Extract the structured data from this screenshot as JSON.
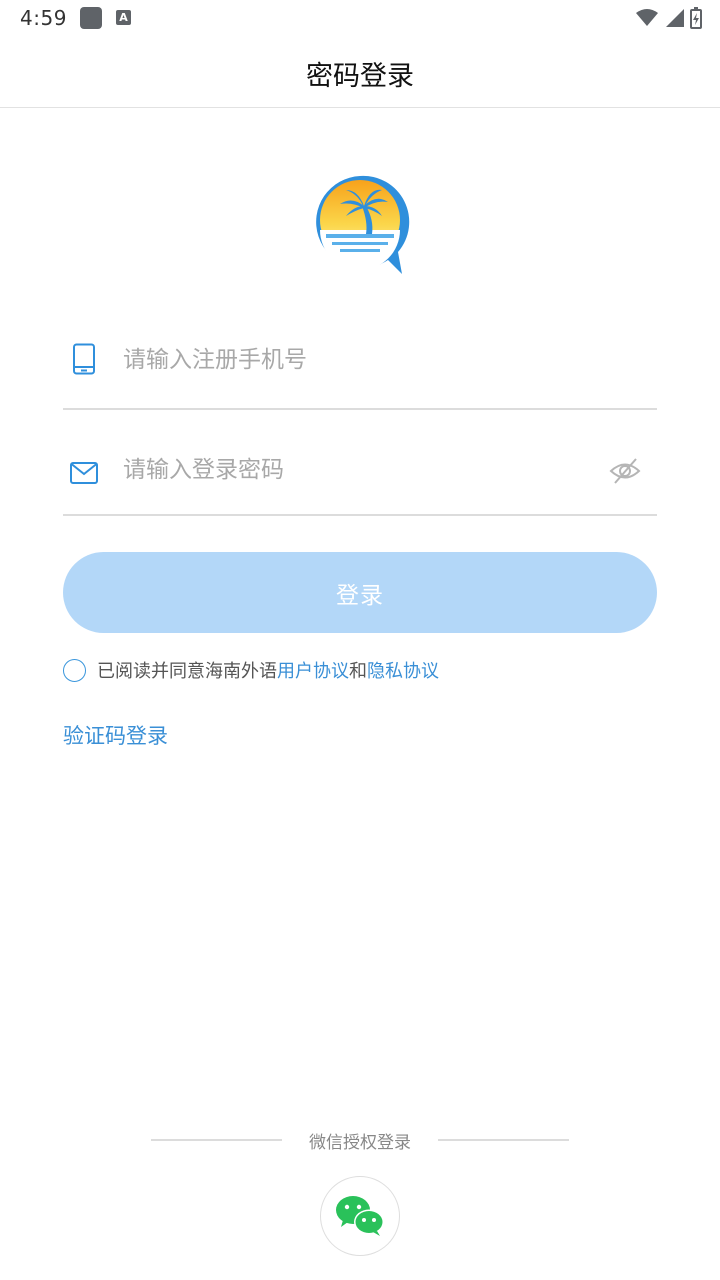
{
  "status_bar": {
    "time": "4:59",
    "a_icon_glyph": "A",
    "icons": [
      "app-icon",
      "a-icon",
      "wifi-icon",
      "signal-icon",
      "battery-icon"
    ]
  },
  "header": {
    "title": "密码登录"
  },
  "form": {
    "phone": {
      "placeholder": "请输入注册手机号",
      "value": "",
      "icon": "phone-icon"
    },
    "password": {
      "placeholder": "请输入登录密码",
      "value": "",
      "icon": "mail-icon",
      "toggle_icon": "eye-hidden-icon"
    },
    "login_button_label": "登录"
  },
  "agreement": {
    "prefix": "已阅读并同意海南外语",
    "user_agreement": "用户协议",
    "conjunction": "和",
    "privacy_agreement": "隐私协议",
    "checked": false
  },
  "code_login_label": "验证码登录",
  "wechat": {
    "label": "微信授权登录",
    "icon": "wechat-icon"
  },
  "colors": {
    "accent": "#3a8fd6",
    "button_disabled": "#b3d7f8",
    "wechat_green": "#2ac15a"
  }
}
